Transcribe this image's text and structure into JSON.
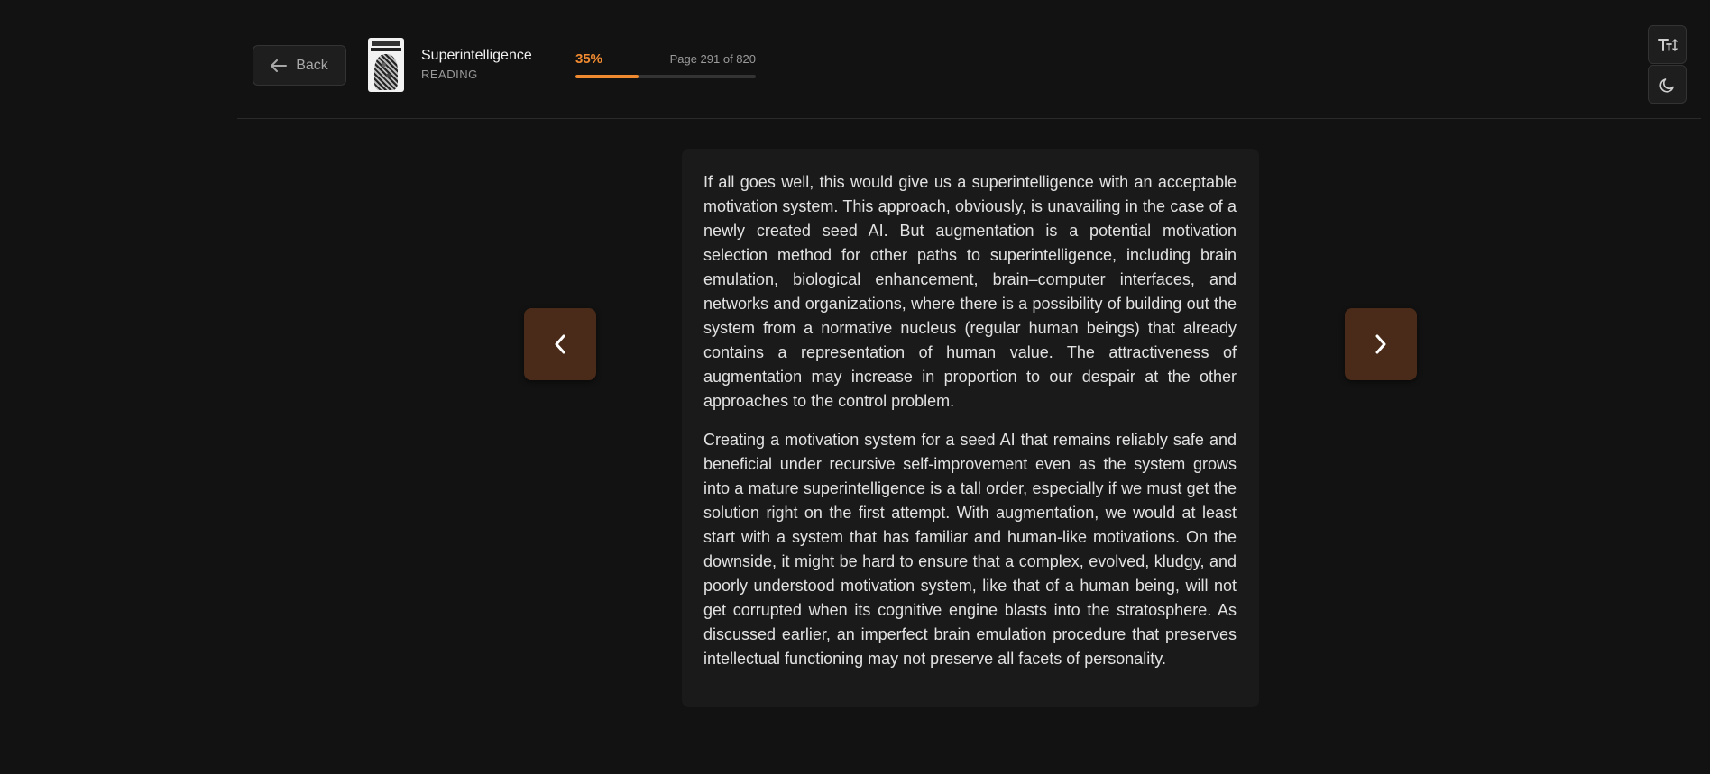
{
  "header": {
    "back_label": "Back",
    "book_title": "Superintelligence",
    "book_status": "READING",
    "progress_percent_label": "35%",
    "progress_fraction": 0.35,
    "page_label": "Page 291 of 820"
  },
  "colors": {
    "accent": "#f08a30",
    "nav_button_bg": "#4a2a18",
    "background": "#121212",
    "card_background": "#1a1a1a"
  },
  "icons": {
    "back": "arrow-left-icon",
    "text_size": "text-size-icon",
    "theme": "moon-icon",
    "prev": "chevron-left-icon",
    "next": "chevron-right-icon"
  },
  "content": {
    "paragraphs": [
      "If all goes well, this would give us a superintelligence with an acceptable motivation system. This approach, obviously, is unavailing in the case of a newly created seed AI. But augmentation is a potential motivation selection method for other paths to superintelligence, including brain emulation, biological enhancement, brain–computer interfaces, and networks and organizations, where there is a possibility of building out the system from a normative nucleus (regular human beings) that already contains a representation of human value. The attractiveness of augmentation may increase in proportion to our despair at the other approaches to the control problem.",
      "Creating a motivation system for a seed AI that remains reliably safe and beneficial under recursive self-improvement even as the system grows into a mature superintelligence is a tall order, especially if we must get the solution right on the first attempt. With augmentation, we would at least start with a system that has familiar and human-like motivations. On the downside, it might be hard to ensure that a complex, evolved, kludgy, and poorly understood motivation system, like that of a human being, will not get corrupted when its cognitive engine blasts into the stratosphere. As discussed earlier, an imperfect brain emulation procedure that preserves intellectual functioning may not preserve all facets of personality."
    ]
  }
}
